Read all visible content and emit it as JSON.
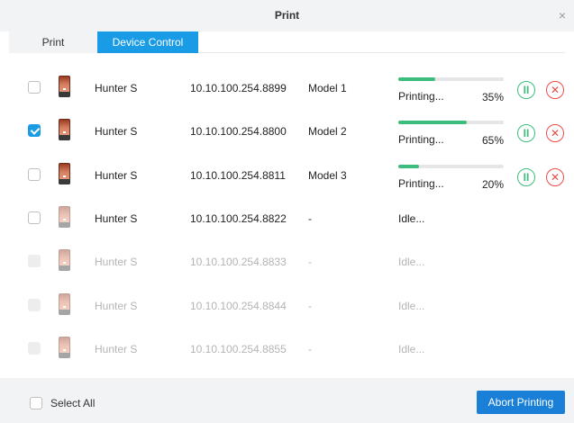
{
  "window": {
    "title": "Print",
    "close_glyph": "×"
  },
  "tabs": [
    {
      "label": "Print",
      "active": false
    },
    {
      "label": "Device Control",
      "active": true
    }
  ],
  "icons": {
    "device": "printer-device-icon",
    "pause": "pause-icon",
    "stop": "stop-icon"
  },
  "colors": {
    "accent": "#1a9be6",
    "progress": "#3dbd7d",
    "stop": "#e94b4b",
    "abort_button": "#1a7fd6"
  },
  "devices": [
    {
      "name": "Hunter S",
      "ip": "10.10.100.254.8899",
      "model": "Model 1",
      "status": "Printing...",
      "progress": 35,
      "progress_label": "35%",
      "checked": false,
      "enabled": true,
      "controls": {
        "pause": "II",
        "stop": "✕"
      }
    },
    {
      "name": "Hunter S",
      "ip": "10.10.100.254.8800",
      "model": "Model 2",
      "status": "Printing...",
      "progress": 65,
      "progress_label": "65%",
      "checked": true,
      "enabled": true,
      "controls": {
        "pause": "II",
        "stop": "✕"
      }
    },
    {
      "name": "Hunter S",
      "ip": "10.10.100.254.8811",
      "model": "Model 3",
      "status": "Printing...",
      "progress": 20,
      "progress_label": "20%",
      "checked": false,
      "enabled": true,
      "controls": {
        "pause": "II",
        "stop": "✕"
      }
    },
    {
      "name": "Hunter S",
      "ip": "10.10.100.254.8822",
      "model": "-",
      "status": "Idle...",
      "checked": false,
      "enabled": true
    },
    {
      "name": "Hunter S",
      "ip": "10.10.100.254.8833",
      "model": "-",
      "status": "Idle...",
      "checked": false,
      "enabled": false
    },
    {
      "name": "Hunter S",
      "ip": "10.10.100.254.8844",
      "model": "-",
      "status": "Idle...",
      "checked": false,
      "enabled": false
    },
    {
      "name": "Hunter S",
      "ip": "10.10.100.254.8855",
      "model": "-",
      "status": "Idle...",
      "checked": false,
      "enabled": false
    }
  ],
  "footer": {
    "select_all_label": "Select All",
    "abort_label": "Abort Printing"
  }
}
